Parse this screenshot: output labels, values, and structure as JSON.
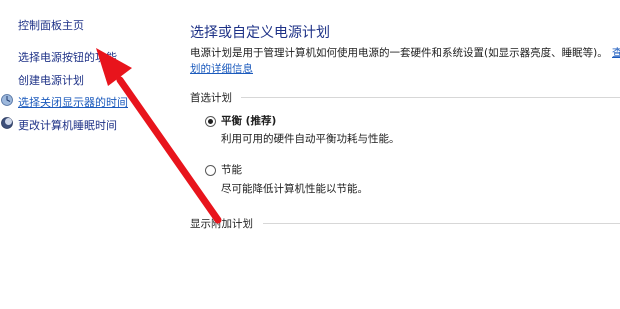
{
  "nav": {
    "items": [
      {
        "label": "控制面板主页",
        "has_icon": false
      },
      {
        "label": "选择电源按钮的功能",
        "has_icon": false
      },
      {
        "label": "创建电源计划",
        "has_icon": false
      },
      {
        "label": "选择关闭显示器的时间",
        "has_icon": true,
        "icon": "monitor-icon"
      },
      {
        "label": "更改计算机睡眠时间",
        "has_icon": true,
        "icon": "moon-icon"
      }
    ]
  },
  "main": {
    "title": "选择或自定义电源计划",
    "description": "电源计划是用于管理计算机如何使用电源的一套硬件和系统设置(如显示器亮度、睡眠等)。",
    "description_link_fragment": "查",
    "detail_link": "划的详细信息",
    "preferred_section": "首选计划",
    "plans": [
      {
        "name": "平衡 (推荐)",
        "description": "利用可用的硬件自动平衡功耗与性能。",
        "selected": true
      },
      {
        "name": "节能",
        "description": "尽可能降低计算机性能以节能。",
        "selected": false
      }
    ],
    "additional_section": "显示附加计划"
  },
  "colors": {
    "link": "#1c5bbd",
    "title": "#1e3287",
    "arrow": "#e8141c",
    "rule": "#d7d7d7"
  }
}
